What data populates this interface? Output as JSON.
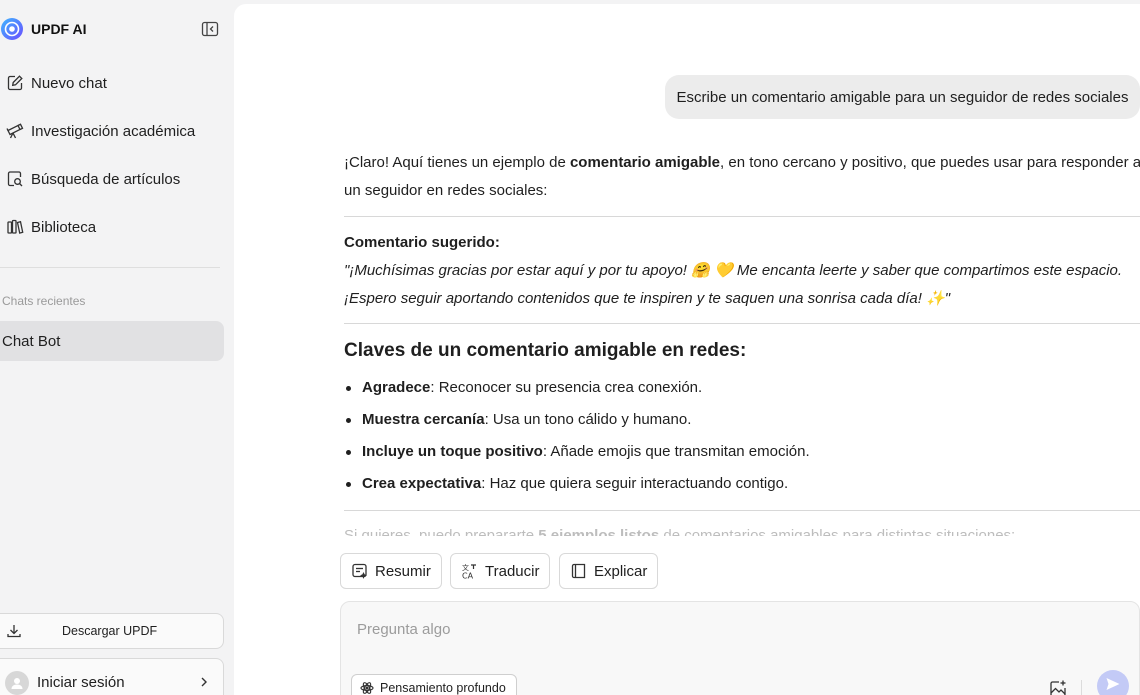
{
  "colors": {
    "accent": "#5b6ef5",
    "send_disabled": "#c3caf6",
    "sidebar_bg": "#f3f3f4",
    "active_item_bg": "#e1e1e3"
  },
  "sidebar": {
    "brand": {
      "title": "UPDF AI",
      "icon": "updf-logo-icon"
    },
    "collapse_icon": "sidebar-collapse-icon",
    "nav": [
      {
        "label": "Nuevo chat",
        "icon": "new-chat-icon"
      },
      {
        "label": "Investigación académica",
        "icon": "telescope-icon"
      },
      {
        "label": "Búsqueda de artículos",
        "icon": "document-search-icon"
      },
      {
        "label": "Biblioteca",
        "icon": "library-icon"
      }
    ],
    "recent_label": "Chats recientes",
    "recent_chats": [
      {
        "label": "Chat Bot",
        "active": true
      }
    ],
    "download_label": "Descargar UPDF",
    "login_label": "Iniciar sesión"
  },
  "conversation": {
    "user_message": "Escribe un comentario amigable para un seguidor de redes sociales",
    "answer": {
      "intro_1": "¡Claro! Aquí tienes un ejemplo de ",
      "intro_bold": "comentario amigable",
      "intro_2": ", en tono cercano y positivo, que puedes usar para responder a un seguidor en redes sociales:",
      "suggested_label": "Comentario sugerido:",
      "suggested_line_1": "\"¡Muchísimas gracias por estar aquí y por tu apoyo! 🤗 💛 Me encanta leerte y saber que compartimos este espacio.",
      "suggested_line_2": "¡Espero seguir aportando contenidos que te inspiren y te saquen una sonrisa cada día! ✨\"",
      "heading": "Claves de un comentario amigable en redes:",
      "bullets": [
        {
          "bold": "Agradece",
          "text": ": Reconocer su presencia crea conexión."
        },
        {
          "bold": "Muestra cercanía",
          "text": ": Usa un tono cálido y humano."
        },
        {
          "bold": "Incluye un toque positivo",
          "text": ": Añade emojis que transmitan emoción."
        },
        {
          "bold": "Crea expectativa",
          "text": ": Haz que quiera seguir interactuando contigo."
        }
      ],
      "fade_1": "Si quieres, puedo prepararte ",
      "fade_bold": "5 ejemplos listos",
      "fade_2": " de comentarios amigables para distintas situaciones:"
    }
  },
  "actions": [
    {
      "label": "Resumir",
      "icon": "summarize-icon"
    },
    {
      "label": "Traducir",
      "icon": "translate-icon"
    },
    {
      "label": "Explicar",
      "icon": "book-icon"
    }
  ],
  "composer": {
    "placeholder": "Pregunta algo",
    "deep_thinking_label": "Pensamiento profundo",
    "image_icon": "image-add-icon",
    "send_icon": "send-icon"
  }
}
